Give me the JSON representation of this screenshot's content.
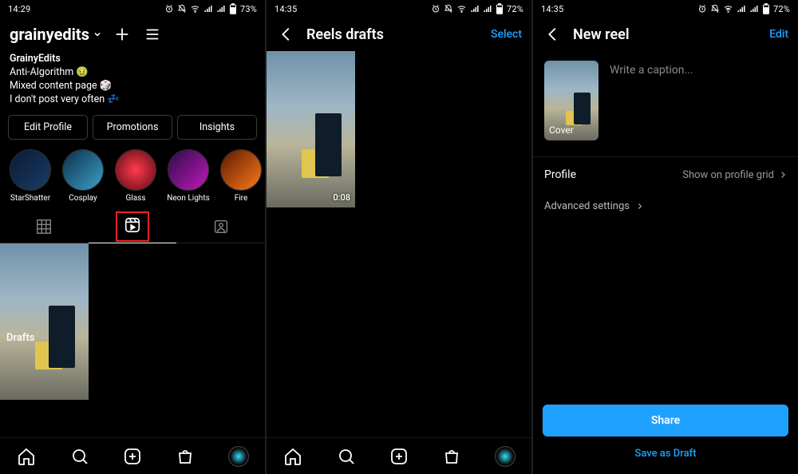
{
  "status": {
    "time_a": "14:29",
    "time_b": "14:35",
    "time_c": "14:35",
    "battery_a": "73%",
    "battery_b": "72%",
    "battery_c": "72%"
  },
  "screen1": {
    "username": "grainyedits",
    "bio_name": "GrainyEdits",
    "bio_l2": "Anti-Algorithm 🤢",
    "bio_l3": "Mixed content page 🎲",
    "bio_l4": "I don't post very often 💤",
    "buttons": {
      "edit": "Edit Profile",
      "promos": "Promotions",
      "insights": "Insights"
    },
    "highlights": [
      {
        "label": "StarShatter",
        "bg": "linear-gradient(135deg,#0b1a33,#1a3d66)"
      },
      {
        "label": "Cosplay",
        "bg": "linear-gradient(135deg,#0e2d4a,#3aa1c8)"
      },
      {
        "label": "Glass",
        "bg": "radial-gradient(circle,#ff3b4d,#5a0a14)"
      },
      {
        "label": "Neon Lights",
        "bg": "linear-gradient(135deg,#2a0b4a,#c21ab8)"
      },
      {
        "label": "Fire",
        "bg": "linear-gradient(135deg,#5a1a00,#ff7a1a)"
      }
    ],
    "drafts_label": "Drafts"
  },
  "screen2": {
    "title": "Reels drafts",
    "select": "Select",
    "duration": "0:08"
  },
  "screen3": {
    "title": "New reel",
    "edit": "Edit",
    "cover": "Cover",
    "caption_placeholder": "Write a caption...",
    "profile_label": "Profile",
    "profile_value": "Show on profile grid",
    "advanced": "Advanced settings",
    "share": "Share",
    "save_draft": "Save as Draft"
  }
}
